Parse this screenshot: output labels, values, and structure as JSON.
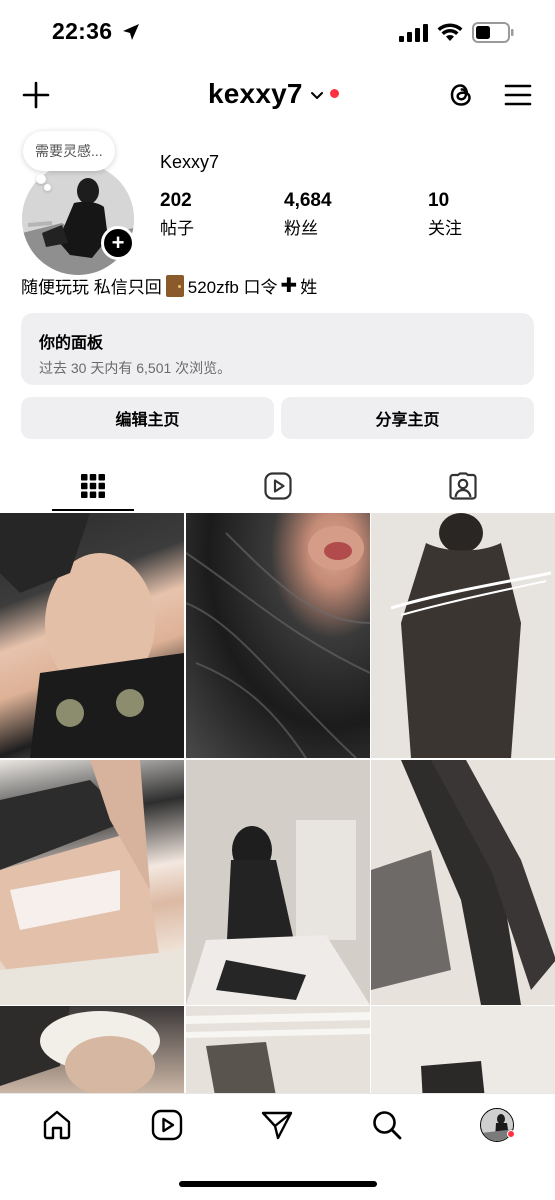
{
  "status_bar": {
    "time": "22:36",
    "icons": [
      "location-arrow-icon",
      "cellular-signal-icon",
      "wifi-icon",
      "battery-icon"
    ]
  },
  "top_nav": {
    "username": "kexxy7",
    "has_notification_dot": true,
    "icons": [
      "plus-icon",
      "chevron-down-icon",
      "threads-icon",
      "hamburger-menu-icon"
    ]
  },
  "profile": {
    "note": "需要灵感...",
    "display_name": "Kexxy7",
    "stats": {
      "posts": {
        "value": "202",
        "label": "帖子"
      },
      "followers": {
        "value": "4,684",
        "label": "粉丝"
      },
      "following": {
        "value": "10",
        "label": "关注"
      }
    },
    "bio": {
      "part1": "随便玩玩 私信只回",
      "part2": "520zfb 口令",
      "part3": "姓"
    }
  },
  "dashboard": {
    "title": "你的面板",
    "subtitle": "过去 30 天内有 6,501 次浏览。"
  },
  "actions": {
    "edit": "编辑主页",
    "share": "分享主页"
  },
  "tabs": [
    {
      "name": "posts-grid",
      "icon": "grid-icon",
      "active": true
    },
    {
      "name": "reels",
      "icon": "reels-icon",
      "active": false
    },
    {
      "name": "tagged",
      "icon": "tagged-person-icon",
      "active": false
    }
  ],
  "grid": {
    "tile_count_visible": 9
  },
  "bottom_nav": {
    "items": [
      "home-icon",
      "reels-icon",
      "direct-send-icon",
      "search-icon",
      "profile-avatar"
    ],
    "profile_has_dot": true
  },
  "colors": {
    "notification_red": "#ff3040",
    "button_bg": "#efeff2",
    "secondary_text": "#6b6b6b"
  }
}
